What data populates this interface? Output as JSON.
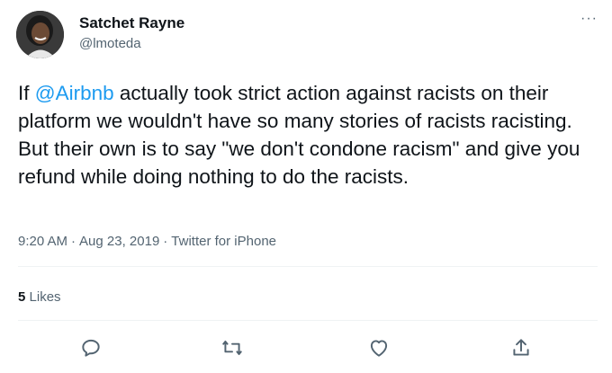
{
  "author": {
    "name": "Satchet Rayne",
    "handle": "@lmoteda",
    "avatar_icon": "profile-photo"
  },
  "menu_icon": "more-horizontal-icon",
  "tweet": {
    "text_before": "If ",
    "mention": "@Airbnb",
    "text_after": " actually took strict action against racists on their platform we wouldn't have so many stories of racists racisting. But their own is to say \"we don't condone racism\" and give you refund while doing nothing to do the racists.",
    "mention_color": "#1d9bf0"
  },
  "meta": {
    "time": "9:20 AM",
    "date": "Aug 23, 2019",
    "source": "Twitter for iPhone",
    "separator": "·"
  },
  "stats": {
    "likes_count": "5",
    "likes_label": "Likes"
  },
  "actions": [
    {
      "name": "reply",
      "icon": "reply-icon"
    },
    {
      "name": "retweet",
      "icon": "retweet-icon"
    },
    {
      "name": "like",
      "icon": "heart-icon"
    },
    {
      "name": "share",
      "icon": "share-icon"
    }
  ]
}
